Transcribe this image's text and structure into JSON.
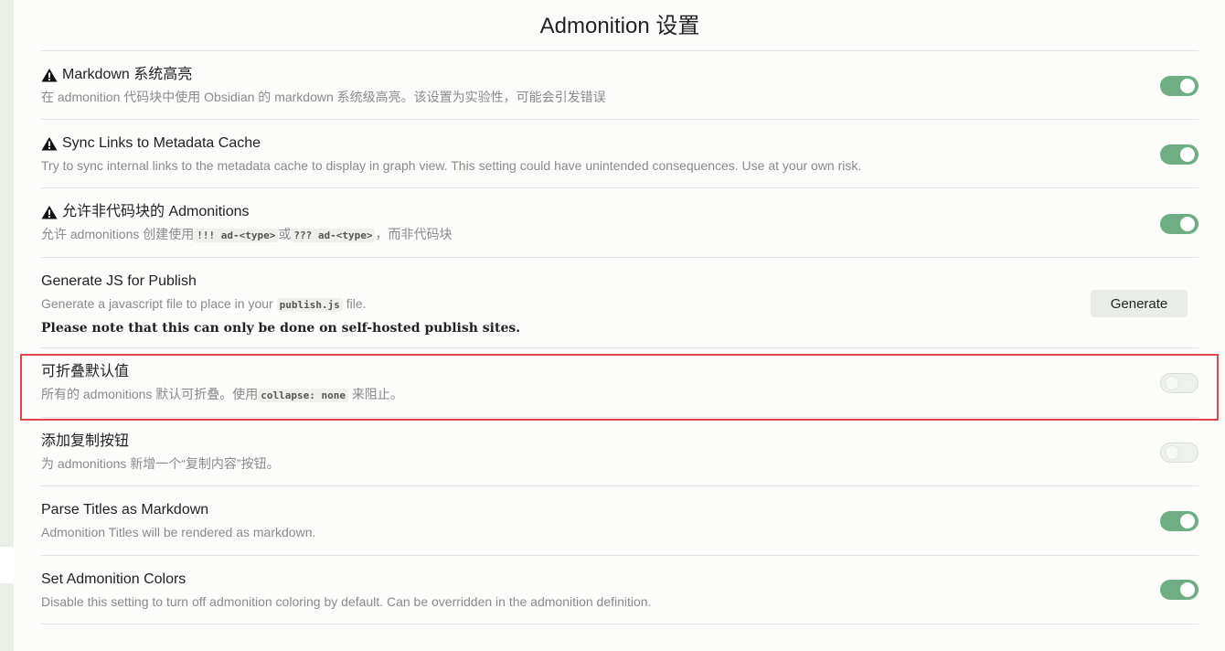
{
  "page_title": "Admonition 设置",
  "settings": [
    {
      "name": "Markdown 系统高亮",
      "warning": true,
      "desc": "在 admonition 代码块中使用 Obsidian 的 markdown 系统级高亮。该设置为实验性，可能会引发错误",
      "control": "toggle",
      "enabled": true
    },
    {
      "name": "Sync Links to Metadata Cache",
      "warning": true,
      "desc": "Try to sync internal links to the metadata cache to display in graph view. This setting could have unintended consequences. Use at your own risk.",
      "control": "toggle",
      "enabled": true
    },
    {
      "name": "允许非代码块的 Admonitions",
      "warning": true,
      "desc_pre": "允许 admonitions 创建使用",
      "code1": "!!! ad-<type>",
      "desc_mid": "或",
      "code2": "??? ad-<type>",
      "desc_post": "，而非代码块",
      "control": "toggle",
      "enabled": true
    },
    {
      "name": "Generate JS for Publish",
      "warning": false,
      "desc_pre": "Generate a javascript file to place in your ",
      "code1": "publish.js",
      "desc_post": " file.",
      "note": "Please note that this can only be done on self-hosted publish sites.",
      "control": "button",
      "button_label": "Generate"
    },
    {
      "name": "可折叠默认值",
      "warning": false,
      "desc_pre": "所有的 admonitions 默认可折叠。使用",
      "code1": "collapse: none",
      "desc_post": " 来阻止。",
      "control": "toggle",
      "enabled": false
    },
    {
      "name": "添加复制按钮",
      "warning": false,
      "desc": "为 admonitions 新增一个“复制内容”按钮。",
      "control": "toggle",
      "enabled": false
    },
    {
      "name": "Parse Titles as Markdown",
      "warning": false,
      "desc": "Admonition Titles will be rendered as markdown.",
      "control": "toggle",
      "enabled": true
    },
    {
      "name": "Set Admonition Colors",
      "warning": false,
      "desc": "Disable this setting to turn off admonition coloring by default. Can be overridden in the admonition definition.",
      "control": "toggle",
      "enabled": true
    }
  ],
  "icons": {
    "warning": "warning-triangle-icon"
  },
  "colors": {
    "toggle_on": "#6fad84",
    "highlight": "#e0474c"
  }
}
